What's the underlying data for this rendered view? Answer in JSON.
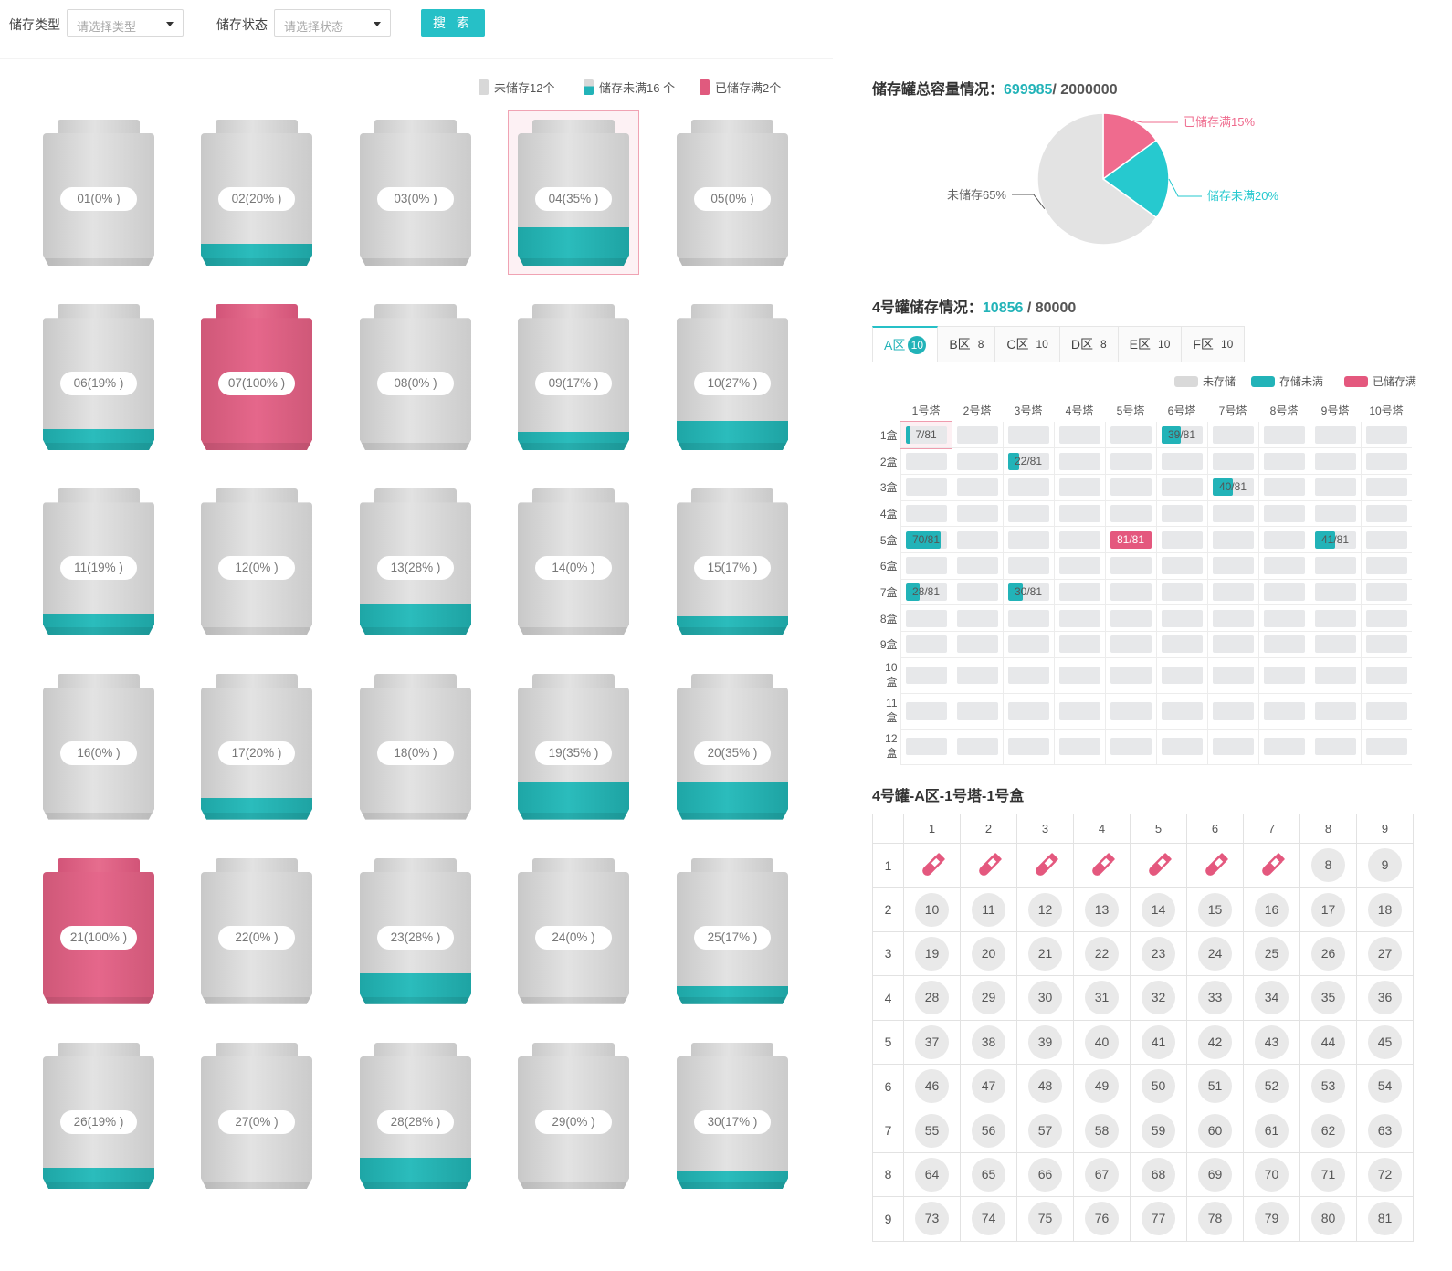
{
  "filters": {
    "type_label": "储存类型",
    "type_placeholder": "请选择类型",
    "status_label": "储存状态",
    "status_placeholder": "请选择状态",
    "search_label": "搜 索"
  },
  "legend": {
    "empty": "未储存12个",
    "partial": "储存未满16 个",
    "full": "已储存满2个"
  },
  "colors": {
    "accent": "#22b3b8",
    "full": "#e4587e",
    "empty": "#d6d6d6"
  },
  "tanks": [
    {
      "label": "01(0% )",
      "fill": 0,
      "status": "empty"
    },
    {
      "label": "02(20% )",
      "fill": 0.2,
      "status": "partial"
    },
    {
      "label": "03(0% )",
      "fill": 0,
      "status": "empty"
    },
    {
      "label": "04(35% )",
      "fill": 0.35,
      "status": "partial",
      "selected": true
    },
    {
      "label": "05(0% )",
      "fill": 0,
      "status": "empty"
    },
    {
      "label": "06(19% )",
      "fill": 0.19,
      "status": "partial"
    },
    {
      "label": "07(100% )",
      "fill": 1,
      "status": "full"
    },
    {
      "label": "08(0% )",
      "fill": 0,
      "status": "empty"
    },
    {
      "label": "09(17% )",
      "fill": 0.17,
      "status": "partial"
    },
    {
      "label": "10(27% )",
      "fill": 0.27,
      "status": "partial"
    },
    {
      "label": "11(19% )",
      "fill": 0.19,
      "status": "partial"
    },
    {
      "label": "12(0% )",
      "fill": 0,
      "status": "empty"
    },
    {
      "label": "13(28% )",
      "fill": 0.28,
      "status": "partial"
    },
    {
      "label": "14(0% )",
      "fill": 0,
      "status": "empty"
    },
    {
      "label": "15(17% )",
      "fill": 0.17,
      "status": "partial"
    },
    {
      "label": "16(0% )",
      "fill": 0,
      "status": "empty"
    },
    {
      "label": "17(20% )",
      "fill": 0.2,
      "status": "partial"
    },
    {
      "label": "18(0% )",
      "fill": 0,
      "status": "empty"
    },
    {
      "label": "19(35% )",
      "fill": 0.35,
      "status": "partial"
    },
    {
      "label": "20(35% )",
      "fill": 0.35,
      "status": "partial"
    },
    {
      "label": "21(100% )",
      "fill": 1,
      "status": "full"
    },
    {
      "label": "22(0% )",
      "fill": 0,
      "status": "empty"
    },
    {
      "label": "23(28% )",
      "fill": 0.28,
      "status": "partial"
    },
    {
      "label": "24(0% )",
      "fill": 0,
      "status": "empty"
    },
    {
      "label": "25(17% )",
      "fill": 0.17,
      "status": "partial"
    },
    {
      "label": "26(19% )",
      "fill": 0.19,
      "status": "partial"
    },
    {
      "label": "27(0% )",
      "fill": 0,
      "status": "empty"
    },
    {
      "label": "28(28% )",
      "fill": 0.28,
      "status": "partial"
    },
    {
      "label": "29(0% )",
      "fill": 0,
      "status": "empty"
    },
    {
      "label": "30(17% )",
      "fill": 0.17,
      "status": "partial"
    }
  ],
  "capacity": {
    "title": "储存罐总容量情况：",
    "used": "699985",
    "total": "/ 2000000"
  },
  "chart_data": {
    "type": "pie",
    "slices": [
      {
        "label": "已储存满15%",
        "value": 15,
        "color": "#ef6b8e"
      },
      {
        "label": "储存未满20%",
        "value": 20,
        "color": "#26c9cf"
      },
      {
        "label": "未储存65%",
        "value": 65,
        "color": "#e3e3e3"
      }
    ]
  },
  "tank_detail": {
    "title": "4号罐储存情况：",
    "used": "10856",
    "total": " / 80000",
    "tabs": [
      {
        "name": "A区",
        "count": "10",
        "active": true
      },
      {
        "name": "B区",
        "count": "8"
      },
      {
        "name": "C区",
        "count": "10"
      },
      {
        "name": "D区",
        "count": "8"
      },
      {
        "name": "E区",
        "count": "10"
      },
      {
        "name": "F区",
        "count": "10"
      }
    ],
    "legend": {
      "empty": "未存储",
      "partial": "存储未满",
      "full": "已储存满"
    },
    "towers": [
      "1号塔",
      "2号塔",
      "3号塔",
      "4号塔",
      "5号塔",
      "6号塔",
      "7号塔",
      "8号塔",
      "9号塔",
      "10号塔"
    ],
    "boxes": [
      "1盒",
      "2盒",
      "3盒",
      "4盒",
      "5盒",
      "6盒",
      "7盒",
      "8盒",
      "9盒",
      "10盒",
      "11盒",
      "12盒"
    ],
    "filled_cells": [
      {
        "row": 0,
        "col": 0,
        "count": 7,
        "label": "7/81",
        "selected": true
      },
      {
        "row": 0,
        "col": 5,
        "count": 39,
        "label": "39/81"
      },
      {
        "row": 1,
        "col": 2,
        "count": 22,
        "label": "22/81"
      },
      {
        "row": 2,
        "col": 6,
        "count": 40,
        "label": "40/81"
      },
      {
        "row": 4,
        "col": 0,
        "count": 70,
        "label": "70/81"
      },
      {
        "row": 4,
        "col": 4,
        "count": 81,
        "label": "81/81"
      },
      {
        "row": 4,
        "col": 8,
        "count": 41,
        "label": "41/81"
      },
      {
        "row": 6,
        "col": 0,
        "count": 28,
        "label": "28/81"
      },
      {
        "row": 6,
        "col": 2,
        "count": 30,
        "label": "30/81"
      }
    ],
    "capacity_per_box": 81
  },
  "box_detail": {
    "title": "4号罐-A区-1号塔-1号盒",
    "cols": [
      "1",
      "2",
      "3",
      "4",
      "5",
      "6",
      "7",
      "8",
      "9"
    ],
    "rows": [
      "1",
      "2",
      "3",
      "4",
      "5",
      "6",
      "7",
      "8",
      "9"
    ],
    "occupied": [
      1,
      2,
      3,
      4,
      5,
      6,
      7
    ]
  }
}
